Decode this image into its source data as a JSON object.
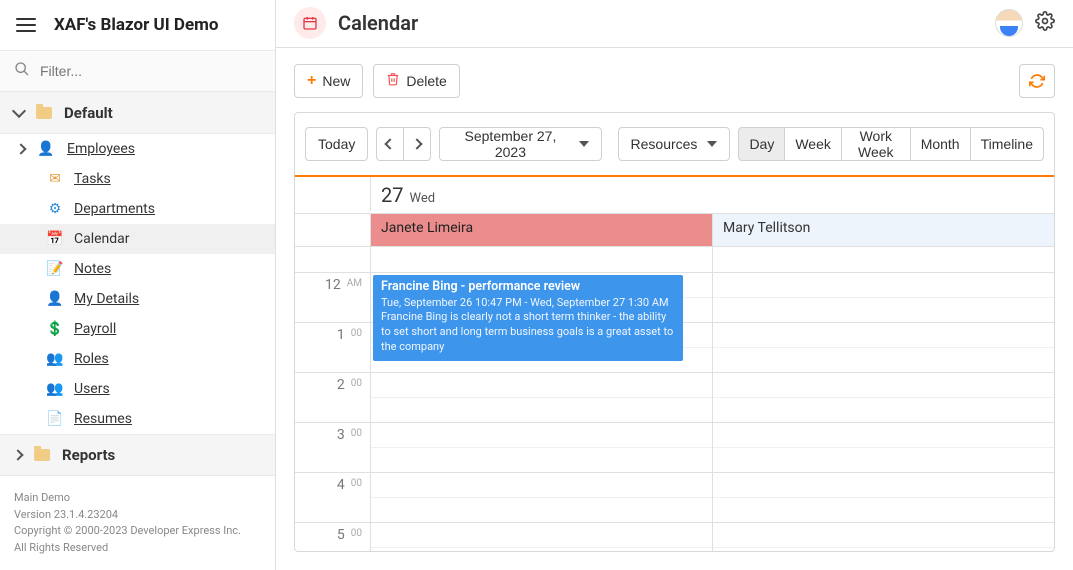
{
  "header": {
    "brand": "XAF's Blazor UI Demo"
  },
  "filter": {
    "placeholder": "Filter..."
  },
  "groups": {
    "default_label": "Default",
    "reports_label": "Reports"
  },
  "nav": {
    "employees": "Employees",
    "tasks": "Tasks",
    "departments": "Departments",
    "calendar": "Calendar",
    "notes": "Notes",
    "my_details": "My Details",
    "payroll": "Payroll",
    "roles": "Roles",
    "users": "Users",
    "resumes": "Resumes"
  },
  "footer": {
    "line1": "Main Demo",
    "line2": "Version 23.1.4.23204",
    "line3": "Copyright © 2000-2023 Developer Express Inc.",
    "line4": "All Rights Reserved"
  },
  "page": {
    "title": "Calendar"
  },
  "toolbar": {
    "new": "New",
    "delete": "Delete"
  },
  "scheduler": {
    "today": "Today",
    "date": "September 27, 2023",
    "resources": "Resources",
    "views": {
      "day": "Day",
      "week": "Week",
      "work_week": "Work Week",
      "month": "Month",
      "timeline": "Timeline"
    },
    "day_num": "27",
    "day_wk": "Wed",
    "res_a": "Janete Limeira",
    "res_b": "Mary Tellitson",
    "min_00": "00",
    "am": "AM",
    "hours": {
      "h12": "12",
      "h1": "1",
      "h2": "2",
      "h3": "3",
      "h4": "4",
      "h5": "5"
    },
    "appt": {
      "title": "Francine Bing - performance review",
      "time": "Tue, September 26 10:47 PM - Wed, September 27 1:30 AM",
      "desc": "Francine Bing is clearly not a short term thinker - the ability to set short and long term business goals is a great asset to the company"
    }
  }
}
